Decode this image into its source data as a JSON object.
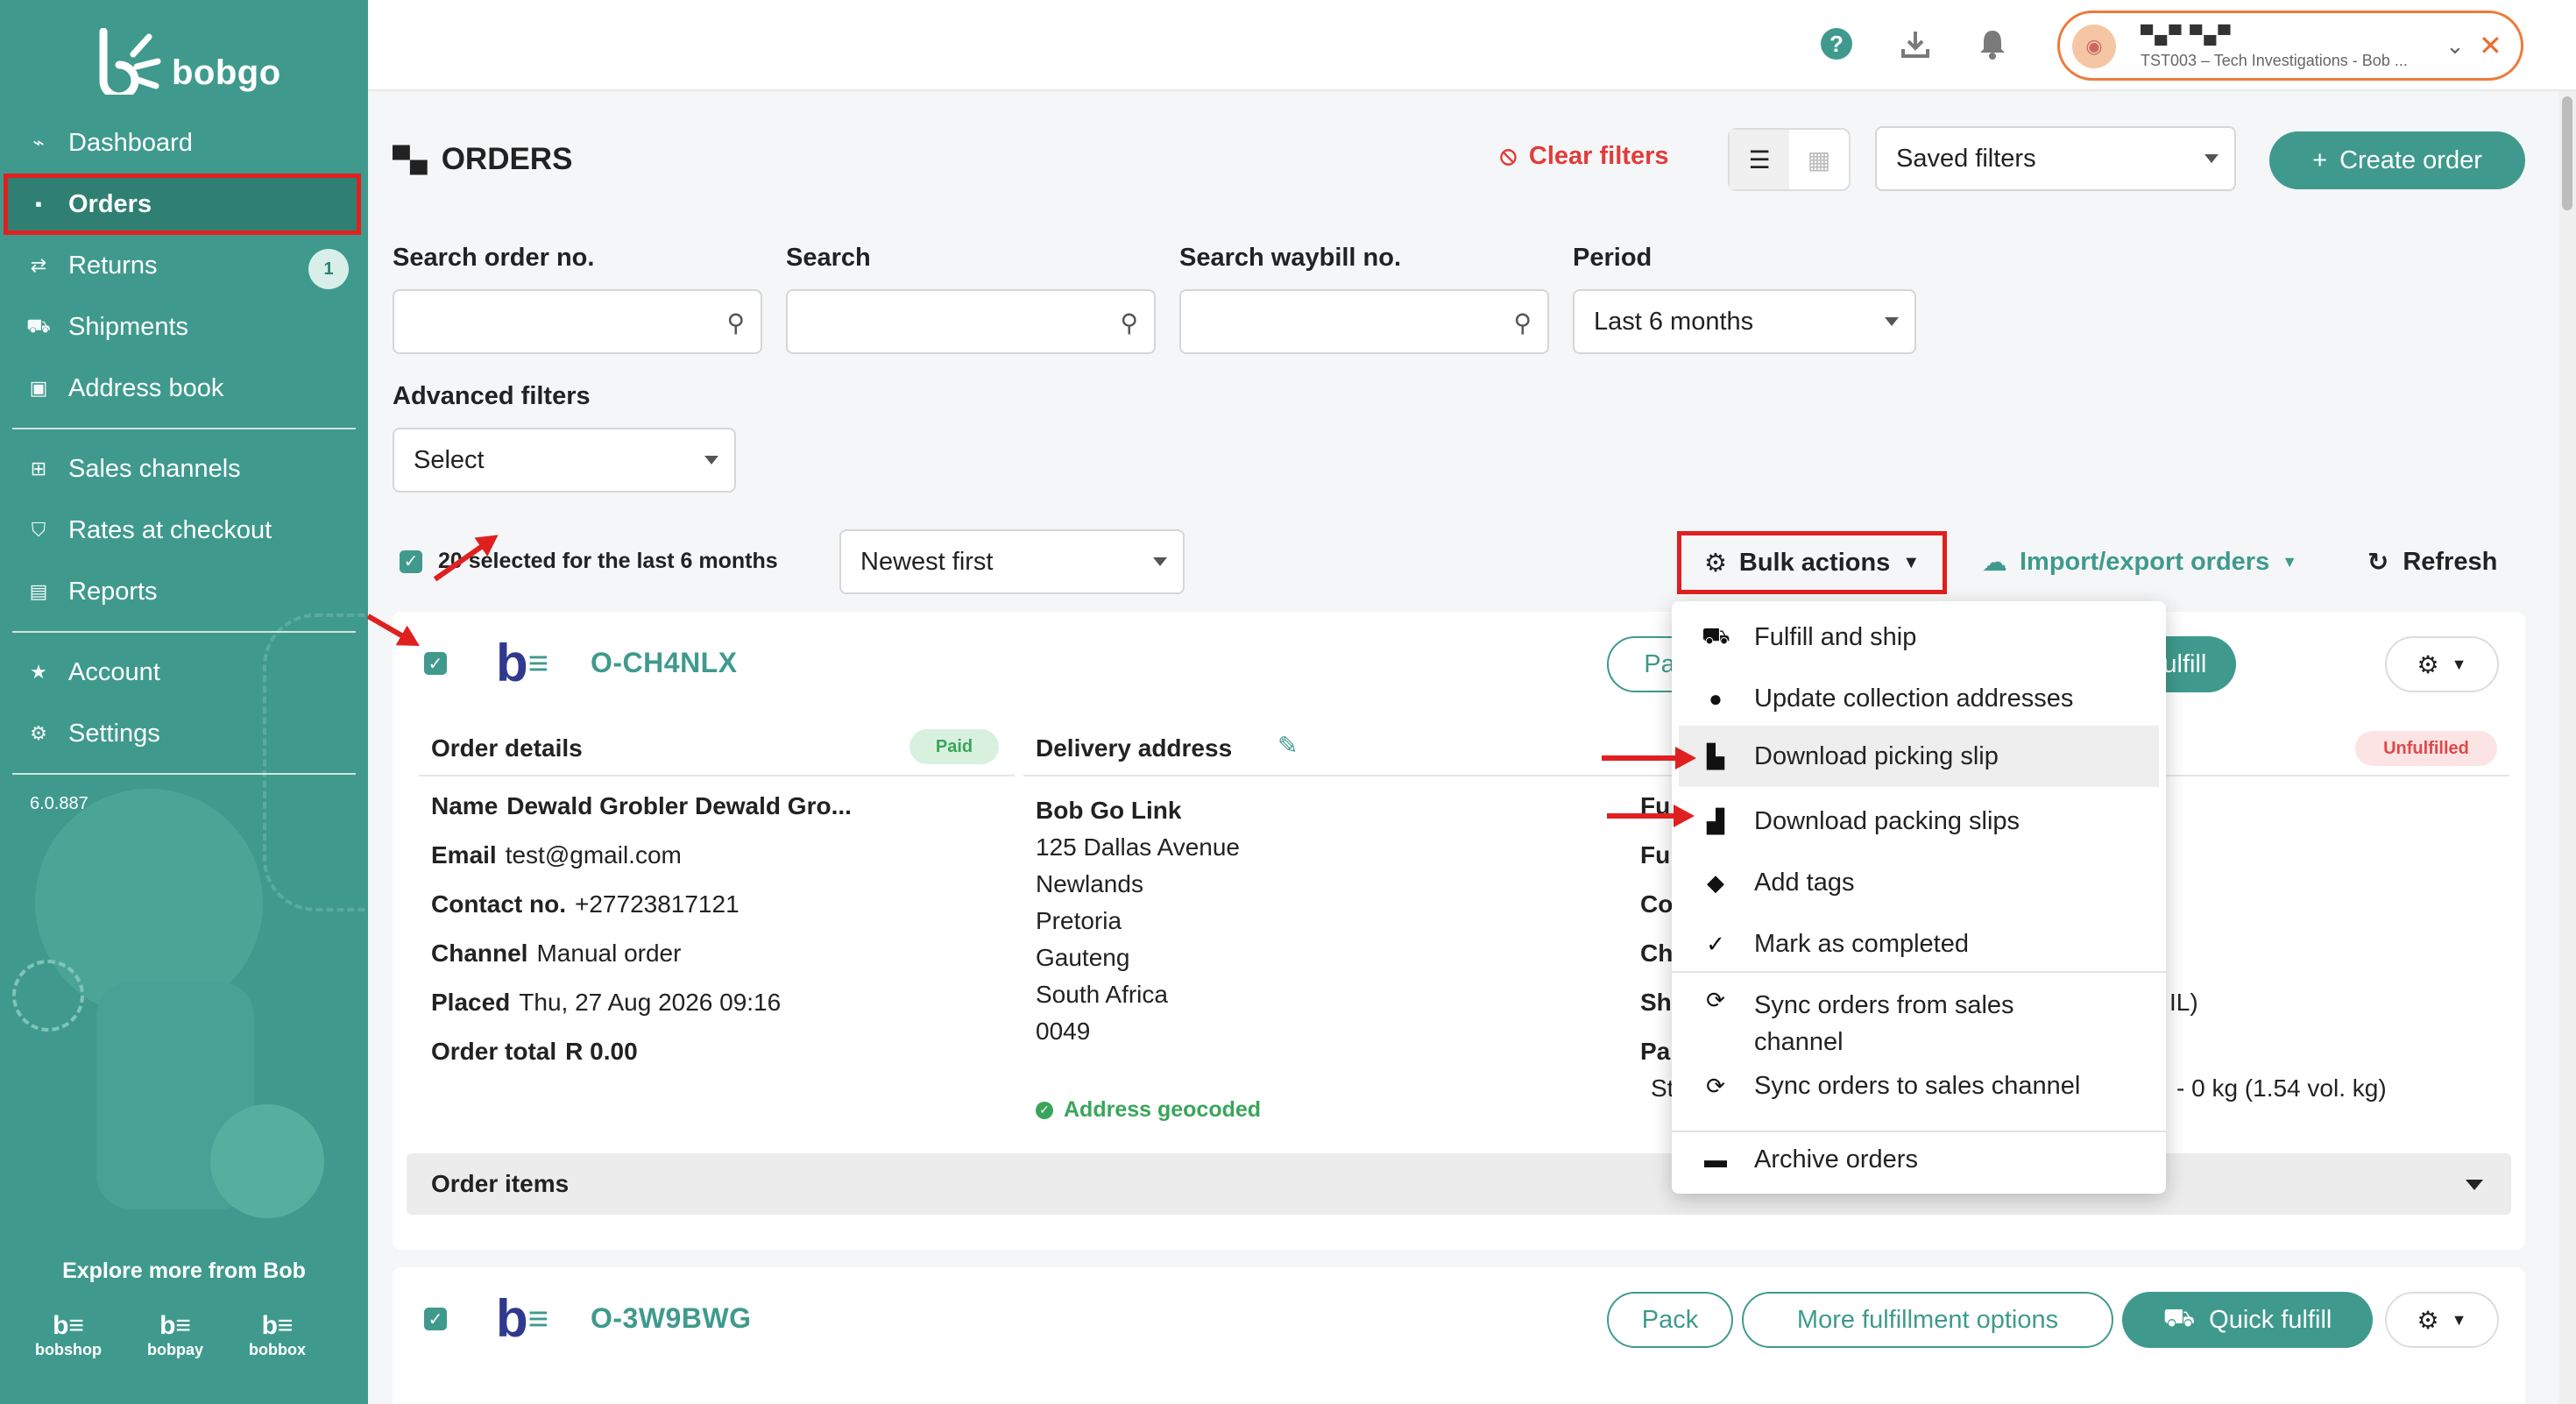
{
  "brand": {
    "name": "bobgo",
    "accent": "#3f9a8d"
  },
  "sidebar": {
    "items": [
      {
        "label": "Dashboard",
        "icon": "chart-line-icon"
      },
      {
        "label": "Orders",
        "icon": "box-icon",
        "active": true
      },
      {
        "label": "Returns",
        "icon": "exchange-icon",
        "badge": "1"
      },
      {
        "label": "Shipments",
        "icon": "truck-icon"
      },
      {
        "label": "Address book",
        "icon": "address-book-icon"
      },
      {
        "label": "Sales channels",
        "icon": "sitemap-icon"
      },
      {
        "label": "Rates at checkout",
        "icon": "cart-icon"
      },
      {
        "label": "Reports",
        "icon": "file-icon"
      },
      {
        "label": "Account",
        "icon": "star-icon"
      },
      {
        "label": "Settings",
        "icon": "gear-icon"
      }
    ],
    "version": "6.0.887",
    "explore_label": "Explore more from Bob",
    "apps": [
      "bobshop",
      "bobpay",
      "bobbox"
    ]
  },
  "topbar": {
    "profile_name": "▀▄▀ ▀▄▀",
    "profile_org": "TST003 – Tech Investigations - Bob ..."
  },
  "header": {
    "title": "ORDERS",
    "clear_filters": "Clear filters",
    "saved_filters": "Saved filters",
    "create_order": "Create order"
  },
  "filters": {
    "search_order_label": "Search order no.",
    "search_label": "Search",
    "search_waybill_label": "Search waybill no.",
    "period_label": "Period",
    "period_value": "Last 6 months",
    "advanced_label": "Advanced filters",
    "advanced_value": "Select"
  },
  "toolbar": {
    "selected_text": "20 selected for the last 6 months",
    "sort_value": "Newest first",
    "bulk_actions": "Bulk actions",
    "import_export": "Import/export orders",
    "refresh": "Refresh"
  },
  "bulk_menu": {
    "items": [
      {
        "label": "Fulfill and ship",
        "icon": "truck-icon"
      },
      {
        "label": "Update collection addresses",
        "icon": "map-pin-icon"
      },
      {
        "label": "Download picking slip",
        "icon": "file-download-icon",
        "hovered": true
      },
      {
        "label": "Download packing slips",
        "icon": "box-open-icon"
      },
      {
        "label": "Add tags",
        "icon": "tags-icon"
      },
      {
        "label": "Mark as completed",
        "icon": "check-icon"
      },
      {
        "label": "Sync orders from sales channel",
        "icon": "sync-icon"
      },
      {
        "label": "Sync orders to sales channel",
        "icon": "sync-icon"
      },
      {
        "label": "Archive orders",
        "icon": "archive-icon"
      }
    ]
  },
  "orders": [
    {
      "order_no": "O-CH4NLX",
      "pack_partial": "Pa",
      "quick_fulfill": "Quick fulfill",
      "order_details_title": "Order details",
      "payment_badge": "Paid",
      "fulfillment_badge": "Unfulfilled",
      "name_label": "Name",
      "name_value": "Dewald Grobler Dewald Gro...",
      "email_label": "Email",
      "email_value": "test@gmail.com",
      "contact_label": "Contact no.",
      "contact_value": "+27723817121",
      "channel_label": "Channel",
      "channel_value": "Manual order",
      "placed_label": "Placed",
      "placed_value": "Thu, 27 Aug 2026 09:16",
      "total_label": "Order total",
      "total_value": "R 0.00",
      "delivery_title": "Delivery address",
      "address_lines": [
        "Bob Go Link",
        "125 Dallas Avenue",
        "Newlands",
        "Pretoria",
        "Gauteng",
        "South Africa",
        "0049"
      ],
      "geocoded": "Address geocoded",
      "fulfillment_fragments": [
        "Fu",
        "Fu",
        "Co",
        "Ch",
        "Sh",
        "Pa",
        "St"
      ],
      "shipping_fragment": "IL)",
      "weight_fragment": "- 0 kg (1.54 vol. kg)",
      "items_title": "Order items"
    },
    {
      "order_no": "O-3W9BWG",
      "pack": "Pack",
      "more_options": "More fulfillment options",
      "quick_fulfill": "Quick fulfill"
    }
  ]
}
